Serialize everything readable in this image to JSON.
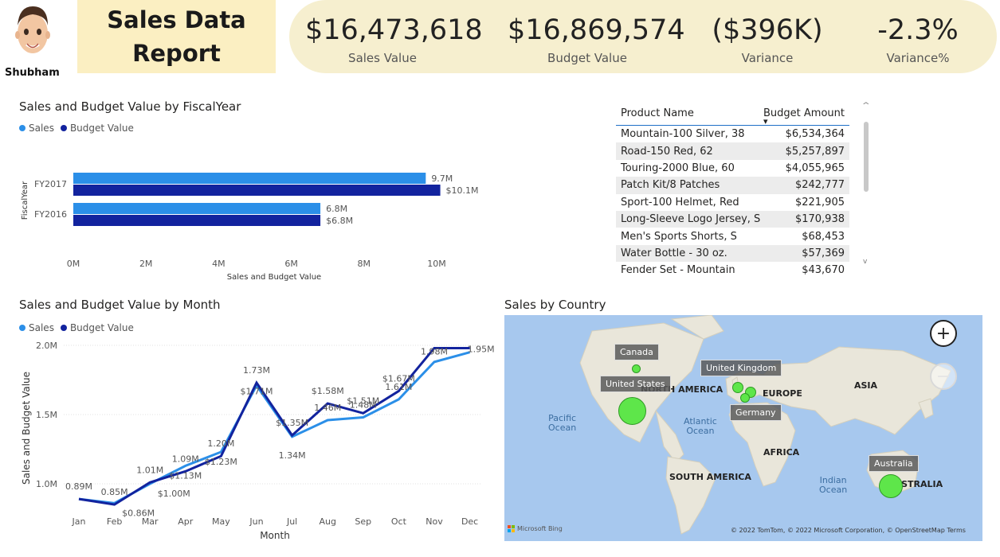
{
  "user": {
    "name": "Shubham",
    "avatar_icon": "memoji-avatar-icon"
  },
  "report_title": "Sales Data\nReport",
  "kpis": [
    {
      "value": "$16,473,618",
      "label": "Sales Value"
    },
    {
      "value": "$16,869,574",
      "label": "Budget Value"
    },
    {
      "value": "($396K)",
      "label": "Variance"
    },
    {
      "value": "-2.3%",
      "label": "Variance%"
    }
  ],
  "colors": {
    "sales": "#2b8fe8",
    "budget": "#12239e",
    "kpi_banner": "#f6efcf",
    "title_box": "#fbefc2",
    "map_bubble": "#5ee64a",
    "map_water": "#a7c8ee",
    "map_land": "#e9e6da"
  },
  "chart_data": [
    {
      "type": "bar",
      "orientation": "horizontal",
      "title": "Sales and Budget Value by FiscalYear",
      "legend": [
        "Sales",
        "Budget Value"
      ],
      "legend_position": "top-left",
      "categories": [
        "FY2017",
        "FY2016"
      ],
      "series": [
        {
          "name": "Sales",
          "values": [
            9.7,
            6.8
          ],
          "labels": [
            "9.7M",
            "6.8M"
          ]
        },
        {
          "name": "Budget Value",
          "values": [
            10.1,
            6.8
          ],
          "labels": [
            "$10.1M",
            "$6.8M"
          ]
        }
      ],
      "xlabel": "Sales and Budget Value",
      "ylabel": "FiscalYear",
      "xlim": [
        0,
        10.5
      ],
      "xticks": [
        "0M",
        "2M",
        "4M",
        "6M",
        "8M",
        "10M"
      ],
      "grid": false
    },
    {
      "type": "line",
      "title": "Sales and Budget Value by Month",
      "legend": [
        "Sales",
        "Budget Value"
      ],
      "legend_position": "top-left",
      "categories": [
        "Jan",
        "Feb",
        "Mar",
        "Apr",
        "May",
        "Jun",
        "Jul",
        "Aug",
        "Sep",
        "Oct",
        "Nov",
        "Dec"
      ],
      "series": [
        {
          "name": "Sales",
          "values": [
            0.89,
            0.86,
            1.0,
            1.13,
            1.23,
            1.71,
            1.34,
            1.46,
            1.48,
            1.61,
            1.88,
            1.95
          ],
          "labels": [
            "0.89M",
            "$0.86M",
            "$1.00M",
            "$1.13M",
            "$1.23M",
            "$1.71M",
            "1.34M",
            "1.46M",
            "1.48M",
            "1.61M",
            "",
            ""
          ]
        },
        {
          "name": "Budget Value",
          "values": [
            0.89,
            0.85,
            1.01,
            1.09,
            1.2,
            1.73,
            1.35,
            1.58,
            1.51,
            1.67,
            1.98,
            1.98
          ],
          "labels": [
            "",
            "0.85M",
            "1.01M",
            "1.09M",
            "1.20M",
            "1.73M",
            "$1.35M",
            "$1.58M",
            "$1.51M",
            "$1.67M",
            "1.98M",
            "1.95M"
          ]
        }
      ],
      "xlabel": "Month",
      "ylabel": "Sales and Budget Value",
      "ylim": [
        0.8,
        2.05
      ],
      "yticks": [
        "1.0M",
        "1.5M",
        "2.0M"
      ],
      "grid": true
    },
    {
      "type": "table",
      "columns": [
        "Product Name",
        "Budget Amount"
      ],
      "sort_indicator": "▾",
      "rows": [
        [
          "Mountain-100 Silver, 38",
          "$6,534,364"
        ],
        [
          "Road-150 Red, 62",
          "$5,257,897"
        ],
        [
          "Touring-2000 Blue, 60",
          "$4,055,965"
        ],
        [
          "Patch Kit/8 Patches",
          "$242,777"
        ],
        [
          "Sport-100 Helmet, Red",
          "$221,905"
        ],
        [
          "Long-Sleeve Logo Jersey, S",
          "$170,938"
        ],
        [
          "Men's Sports Shorts, S",
          "$68,453"
        ],
        [
          "Water Bottle - 30 oz.",
          "$57,369"
        ],
        [
          "Fender Set - Mountain",
          "$43,670"
        ]
      ]
    }
  ],
  "map": {
    "title": "Sales by Country",
    "continents": [
      "NORTH AMERICA",
      "EUROPE",
      "ASIA",
      "AFRICA",
      "SOUTH AMERICA",
      "AUSTRALIA"
    ],
    "oceans": [
      "Pacific\nOcean",
      "Atlantic\nOcean",
      "Indian\nOcean"
    ],
    "countries": [
      "Canada",
      "United States",
      "United Kingdom",
      "Germany",
      "Australia"
    ],
    "zoom_in": "+",
    "zoom_out": "−",
    "bing_label": "Microsoft Bing",
    "copyright": "© 2022 TomTom, © 2022 Microsoft Corporation, © OpenStreetMap  Terms"
  },
  "scroll": {
    "up": "^",
    "down": "v"
  }
}
